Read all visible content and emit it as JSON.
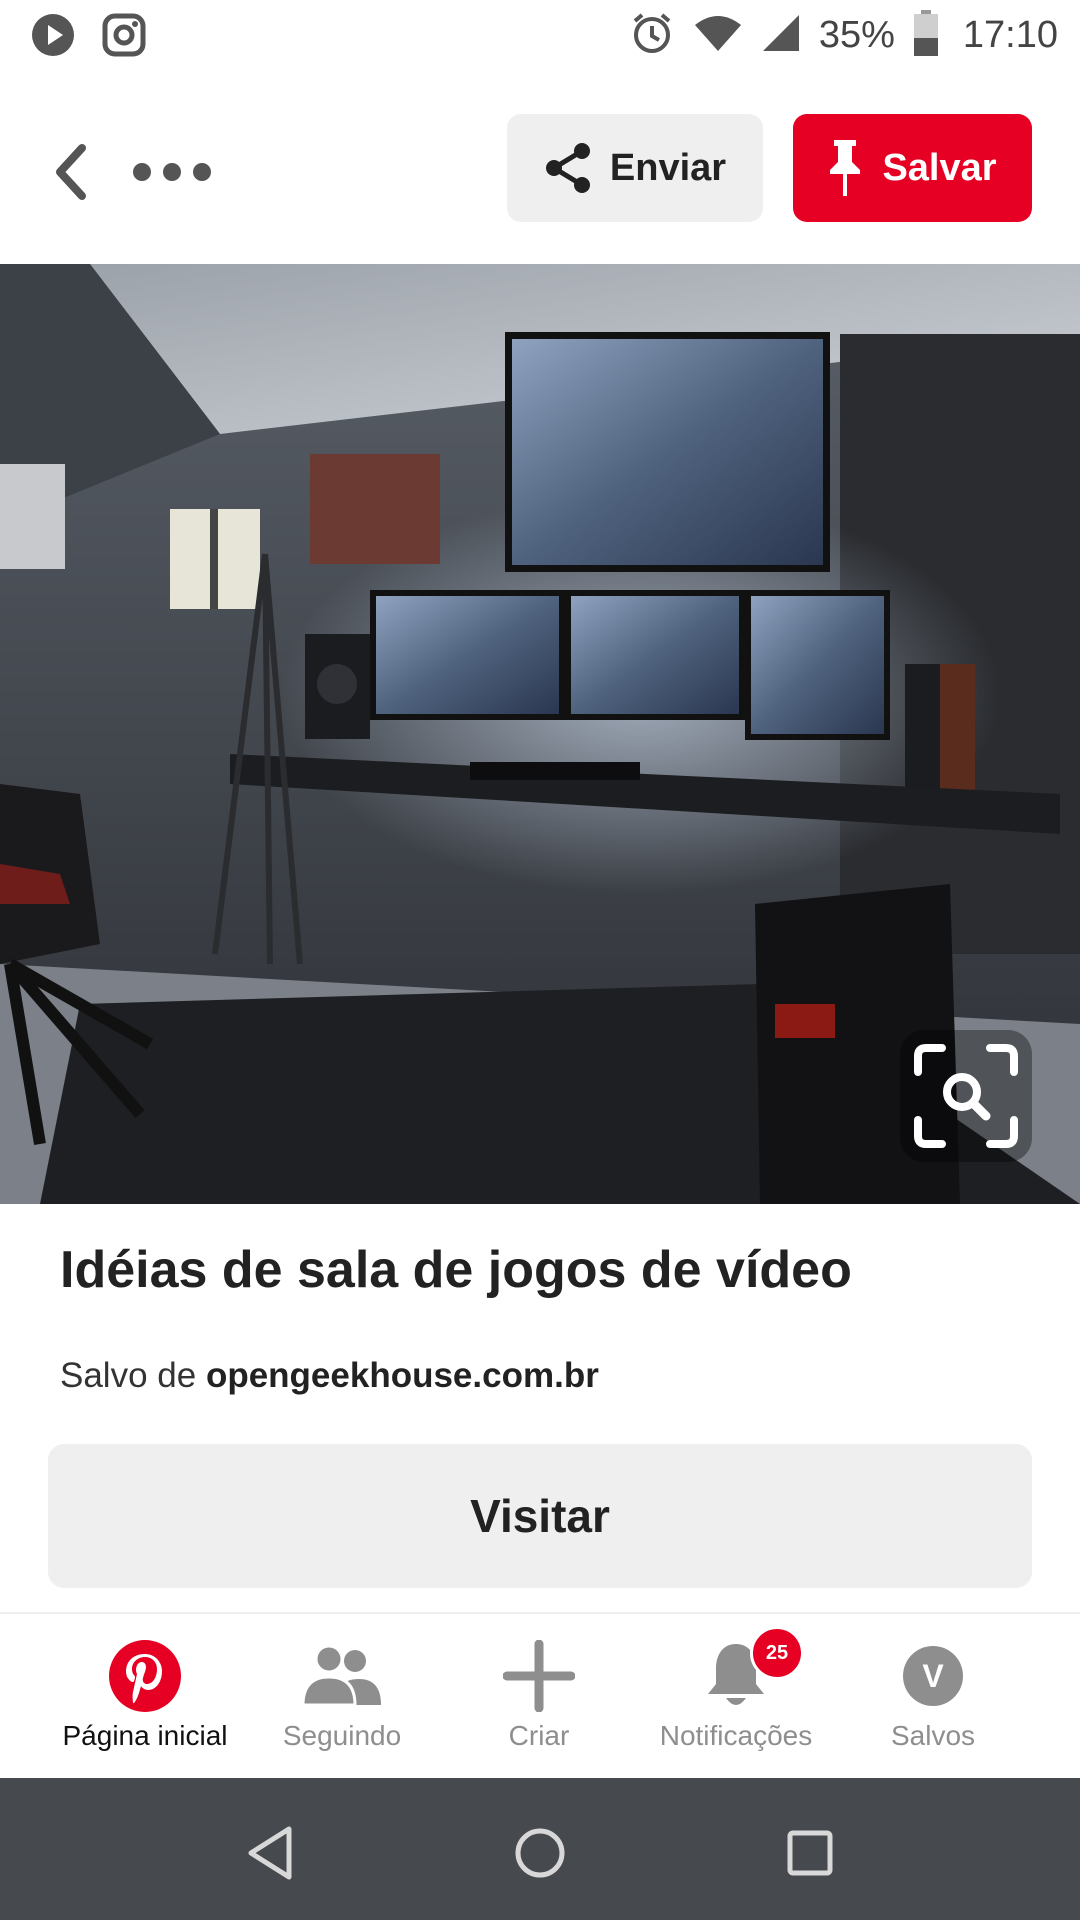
{
  "status_bar": {
    "battery_percent": "35%",
    "time": "17:10",
    "icons": [
      "play-icon",
      "instagram-icon",
      "alarm-icon",
      "wifi-icon",
      "signal-icon",
      "battery-icon"
    ]
  },
  "header": {
    "send_label": "Enviar",
    "save_label": "Salvar"
  },
  "pin": {
    "title": "Idéias de sala de jogos de vídeo",
    "source_prefix": "Salvo de",
    "source_domain": "opengeekhouse.com.br",
    "visit_label": "Visitar"
  },
  "bottom_nav": {
    "items": [
      {
        "label": "Página inicial",
        "icon": "pinterest-logo-icon",
        "active": true
      },
      {
        "label": "Seguindo",
        "icon": "people-icon"
      },
      {
        "label": "Criar",
        "icon": "plus-icon"
      },
      {
        "label": "Notificações",
        "icon": "bell-icon",
        "badge": "25"
      },
      {
        "label": "Salvos",
        "icon": "avatar",
        "avatar_letter": "V"
      }
    ]
  },
  "colors": {
    "brand_red": "#e60023",
    "button_gray": "#efefef",
    "system_nav": "#46494e"
  }
}
